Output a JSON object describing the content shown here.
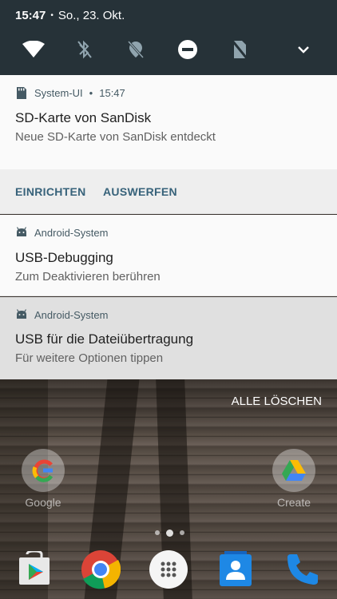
{
  "status_bar": {
    "time": "15:47",
    "separator": "•",
    "date": "So., 23. Okt."
  },
  "quick_settings": {
    "tiles": [
      {
        "icon": "wifi-icon",
        "state": "on"
      },
      {
        "icon": "bluetooth-off-icon",
        "state": "off"
      },
      {
        "icon": "location-off-icon",
        "state": "off"
      },
      {
        "icon": "do-not-disturb-icon",
        "state": "on"
      },
      {
        "icon": "sim-off-icon",
        "state": "off"
      },
      {
        "icon": "expand-chevron-icon",
        "state": "on"
      }
    ]
  },
  "notifications": [
    {
      "app": "System-UI",
      "separator": "•",
      "time": "15:47",
      "app_icon": "sd-card-icon",
      "title": "SD-Karte von SanDisk",
      "text": "Neue SD-Karte von SanDisk entdeckt",
      "actions": [
        "EINRICHTEN",
        "AUSWERFEN"
      ]
    },
    {
      "app": "Android-System",
      "app_icon": "android-icon",
      "title": "USB-Debugging",
      "text": "Zum Deaktivieren berühren"
    },
    {
      "app": "Android-System",
      "app_icon": "android-icon",
      "title": "USB für die Dateiübertragung",
      "text": "Für weitere Optionen tippen"
    }
  ],
  "clear_all_label": "ALLE LÖSCHEN",
  "home": {
    "apps": [
      {
        "label": "Google",
        "icon": "google-icon"
      },
      {
        "label": "Create",
        "icon": "drive-icon"
      }
    ],
    "page_count": 3,
    "active_page": 2,
    "dock": [
      {
        "icon": "play-store-icon"
      },
      {
        "icon": "chrome-icon"
      },
      {
        "icon": "app-drawer-icon"
      },
      {
        "icon": "contacts-icon"
      },
      {
        "icon": "phone-icon"
      }
    ]
  },
  "colors": {
    "qs_background": "#263238",
    "notification_background": "#fafafa",
    "notification_pressed": "#e0e0e0",
    "action_text": "#37627a"
  }
}
